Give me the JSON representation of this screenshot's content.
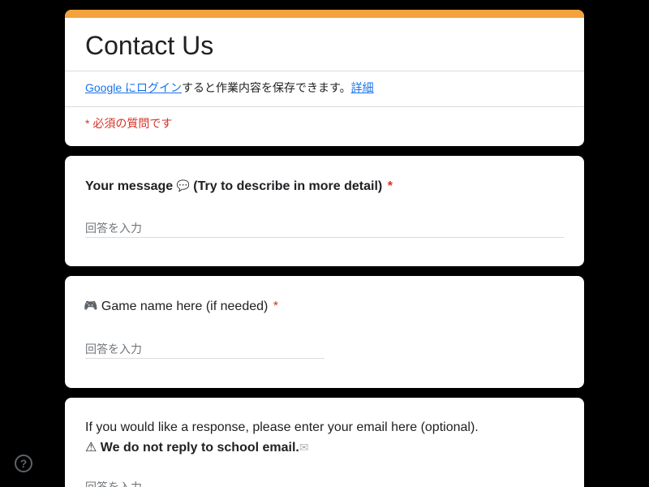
{
  "form": {
    "title": "Contact Us",
    "accent_color": "#f4a23c",
    "login_link": "Google にログイン",
    "login_text": "すると作業内容を保存できます。",
    "learn_more": "詳細",
    "required_note": "* 必須の質問です",
    "required_color": "#d93025"
  },
  "questions": [
    {
      "title_before": "Your message",
      "emoji": "💬",
      "title_after": "(Try to describe in more detail)",
      "required_mark": "*",
      "placeholder": "回答を入力"
    },
    {
      "emoji": "🎮",
      "title": "Game name here (if needed)",
      "required_mark": "*",
      "placeholder": "回答を入力"
    },
    {
      "line1": "If you would like a response, please enter your email here (optional).",
      "warning_icon": "⚠",
      "line2": "We do not reply to school email.",
      "mail_icon": "✉",
      "placeholder": "回答を入力"
    }
  ],
  "help": {
    "label": "?"
  }
}
